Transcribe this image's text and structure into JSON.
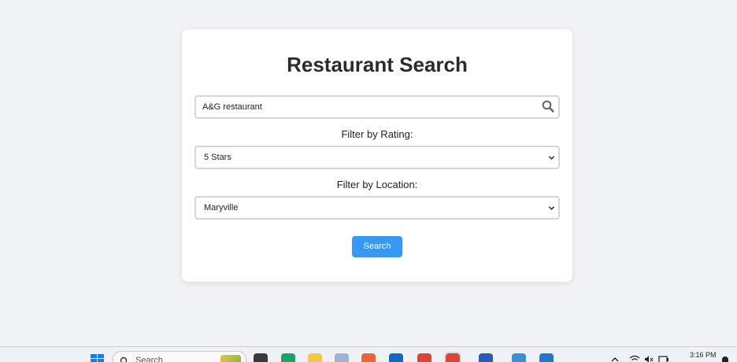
{
  "page": {
    "title": "Restaurant Search"
  },
  "search": {
    "value": "A&G restaurant"
  },
  "rating_filter": {
    "label": "Filter by Rating:",
    "selected": "5 Stars"
  },
  "location_filter": {
    "label": "Filter by Location:",
    "selected": "Maryville"
  },
  "search_button": {
    "label": "Search"
  },
  "taskbar": {
    "search_placeholder": "Search",
    "time": "3:16 PM",
    "apps": [
      "file-explorer-icon",
      "edge-icon",
      "folder-icon",
      "app-icon",
      "firefox-icon",
      "outlook-icon",
      "chrome-icon",
      "chrome-active-icon",
      "word-icon",
      "notepad-icon",
      "vscode-icon"
    ]
  },
  "colors": {
    "background": "#f2f3f5",
    "card": "#ffffff",
    "accent": "#3898f5"
  }
}
